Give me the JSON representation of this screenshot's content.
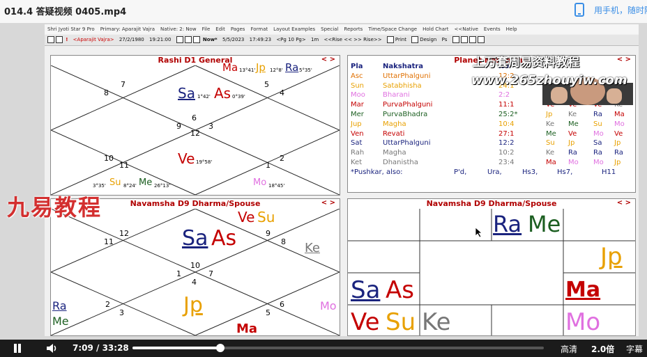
{
  "video": {
    "title": "014.4 答疑视频 0405.mp4",
    "phone_text": "用手机，随时随",
    "time": "7:09 / 33:28",
    "progress": 0.2136,
    "quality": "高清",
    "speed": "2.0倍",
    "subtitle": "字幕"
  },
  "watermarks": {
    "w1": "上万套周易资料教程",
    "w2": "www.265zhouyiw.com",
    "w3": "九易教程"
  },
  "app": {
    "menu": [
      "Shri Jyoti Star 9 Pro",
      "Primary: Aparajit Vajra",
      "Native: 2: Now",
      "File",
      "Edit",
      "Pages",
      "Format",
      "Layout Examples",
      "Special",
      "Reports",
      "Time/Space Change",
      "Hold Chart",
      "<<Native",
      "Events",
      "Help"
    ],
    "toolbar": {
      "native": "<Aparajit Vajra>",
      "birth": "27/2/1980",
      "btime": "19:21:00",
      "now": "Now*",
      "ndate": "5/5/2023",
      "ntime": "17:49:23",
      "pg": "<Pg 10 Pg>",
      "step": "1m",
      "rise": "<<Rise << >> Rise>>",
      "print": "Print",
      "design": "Design",
      "ps": "Ps"
    }
  },
  "rashi": {
    "title": "Rashi D1 General",
    "nav": "< >",
    "houses": [
      "7",
      "8",
      "5",
      "4",
      "6",
      "12",
      "9",
      "3",
      "10",
      "11",
      "1",
      "2"
    ],
    "sa": "Sa",
    "sa_deg": "1°42'",
    "as": "As",
    "as_deg": "0°39'",
    "ma": "Ma",
    "ma_deg": "13°41'",
    "jp": "Jp",
    "jp_deg": "12°8'",
    "ra": "Ra",
    "ra_deg": "5°35'",
    "ve": "Ve",
    "ve_deg": "19°58'",
    "me": "Me",
    "me_deg": "26°13'",
    "su": "Su",
    "su_deg": "8°24'",
    "su2_deg": "3°35'",
    "mo": "Mo",
    "mo_deg": "18°45'"
  },
  "nak": {
    "title": "Planet Nakshatra",
    "nav": "< >",
    "headers": [
      "Pla",
      "Nakshatra",
      "No"
    ],
    "rows": [
      [
        "Asc",
        "UttarPhalguni",
        "12:2",
        "",
        "",
        "",
        ""
      ],
      [
        "Sun",
        "Satabhisha",
        "24:1",
        "Ra",
        "Ra",
        "Mo",
        "Ra"
      ],
      [
        "Moo",
        "Bharani",
        "2:2",
        "Ve",
        "Ra",
        "Sa",
        "Me"
      ],
      [
        "Mar",
        "PurvaPhalguni",
        "11:1",
        "Ve",
        "Ve",
        "Ve",
        "Ke"
      ],
      [
        "Mer",
        "PurvaBhadra",
        "25:2*",
        "Jp",
        "Ke",
        "Ra",
        "Ma"
      ],
      [
        "Jup",
        "Magha",
        "10:4",
        "Ke",
        "Me",
        "Su",
        "Mo"
      ],
      [
        "Ven",
        "Revati",
        "27:1",
        "Me",
        "Ve",
        "Mo",
        "Ve"
      ],
      [
        "Sat",
        "UttarPhalguni",
        "12:2",
        "Su",
        "Jp",
        "Sa",
        "Jp"
      ],
      [
        "Rah",
        "Magha",
        "10:2",
        "Ke",
        "Ra",
        "Ra",
        "Ra"
      ],
      [
        "Ket",
        "Dhanistha",
        "23:4",
        "Ma",
        "Mo",
        "Mo",
        "Jp"
      ]
    ],
    "footer": [
      "*Pushkar, also:",
      "P'd,",
      "Ura,",
      "Hs3,",
      "Hs7,",
      "H11"
    ],
    "colors": {
      "Asc": "#e07000",
      "Sun": "#e8a000",
      "Moo": "#e070e0",
      "Mar": "#c40000",
      "Mer": "#1b5e20",
      "Jup": "#e8a000",
      "Ven": "#c40000",
      "Sat": "#1a237e",
      "Rah": "#777777",
      "Ket": "#777777"
    }
  },
  "d9n": {
    "title": "Navamsha D9 Dharma/Spouse",
    "nav": "< >",
    "houses": [
      "12",
      "11",
      "9",
      "8",
      "10",
      "1",
      "7",
      "4",
      "2",
      "3",
      "5",
      "6"
    ],
    "ve": "Ve",
    "su": "Su",
    "sa": "Sa",
    "as": "As",
    "ke": "Ke",
    "jp": "Jp",
    "ra": "Ra",
    "me": "Me",
    "ma": "Ma",
    "mo": "Mo"
  },
  "d9s": {
    "title": "Navamsha D9 Dharma/Spouse",
    "nav": "< >",
    "ra": "Ra",
    "me": "Me",
    "jp": "Jp",
    "sa": "Sa",
    "as": "As",
    "ma": "Ma",
    "ve": "Ve",
    "su": "Su",
    "ke": "Ke",
    "mo": "Mo"
  }
}
